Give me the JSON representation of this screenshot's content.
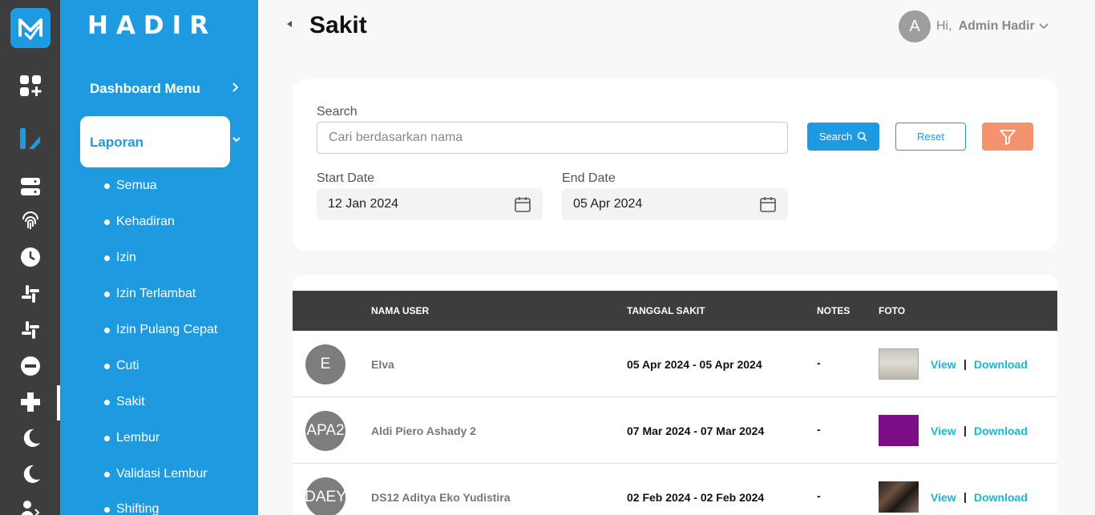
{
  "brand": "HADIR",
  "menu": {
    "dashboard_label": "Dashboard Menu",
    "laporan_label": "Laporan",
    "sub_items": [
      "Semua",
      "Kehadiran",
      "Izin",
      "Izin Terlambat",
      "Izin Pulang Cepat",
      "Cuti",
      "Sakit",
      "Lembur",
      "Validasi Lembur",
      "Shifting"
    ]
  },
  "header": {
    "title": "Sakit",
    "greeting": "Hi,",
    "user_name": "Admin Hadir",
    "avatar_initial": "A"
  },
  "filter": {
    "search_label": "Search",
    "search_placeholder": "Cari berdasarkan nama",
    "search_button": "Search",
    "reset_button": "Reset",
    "start_label": "Start Date",
    "start_value": "12 Jan 2024",
    "end_label": "End Date",
    "end_value": "05 Apr 2024"
  },
  "table": {
    "headers": [
      "NAMA USER",
      "TANGGAL SAKIT",
      "NOTES",
      "FOTO"
    ],
    "rows": [
      {
        "initials": "E",
        "name": "Elva",
        "date": "05 Apr 2024 - 05 Apr 2024",
        "notes": "-",
        "view": "View",
        "sep": "|",
        "download": "Download"
      },
      {
        "initials": "APA2",
        "name": "Aldi Piero Ashady 2",
        "date": "07 Mar 2024 - 07 Mar 2024",
        "notes": "-",
        "view": "View",
        "sep": "|",
        "download": "Download"
      },
      {
        "initials": "DAEY",
        "name": "DS12 Aditya Eko Yudistira",
        "date": "02 Feb 2024 - 02 Feb 2024",
        "notes": "-",
        "view": "View",
        "sep": "|",
        "download": "Download"
      }
    ]
  },
  "colors": {
    "primary": "#1e9be0",
    "rail": "#3d3d3d",
    "filter_button": "#f5926e",
    "link": "#17b7d6"
  }
}
